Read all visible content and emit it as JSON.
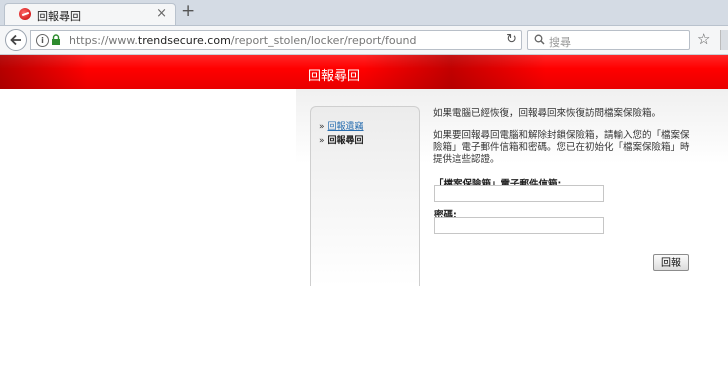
{
  "browser": {
    "tab": {
      "title": "回報尋回",
      "close": "×"
    },
    "new_tab": "+",
    "url": {
      "prefix": "https://www.",
      "host": "trendsecure.com",
      "path": "/report_stolen/locker/report/found"
    },
    "search": {
      "placeholder": "搜尋"
    }
  },
  "page": {
    "banner_title": "回報尋回",
    "sidebar": {
      "items": [
        {
          "arrow": "»",
          "label": "回報遺竊"
        },
        {
          "arrow": "»",
          "label": "回報尋回"
        }
      ]
    },
    "intro": "如果電腦已經恢復，回報尋回來恢復訪問檔案保險箱。",
    "instructions": "如果要回報尋回電腦和解除封鎖保險箱，請輸入您的「檔案保險箱」電子郵件信箱和密碼。您已在初始化「檔案保險箱」時提供這些認證。",
    "form": {
      "email_label": "「檔案保險箱」電子郵件信箱:",
      "email_value": "",
      "password_label": "密碼:",
      "password_value": "",
      "submit_label": "回報"
    }
  },
  "colors": {
    "banner": "#ff0000",
    "link": "#2a6fb0"
  }
}
